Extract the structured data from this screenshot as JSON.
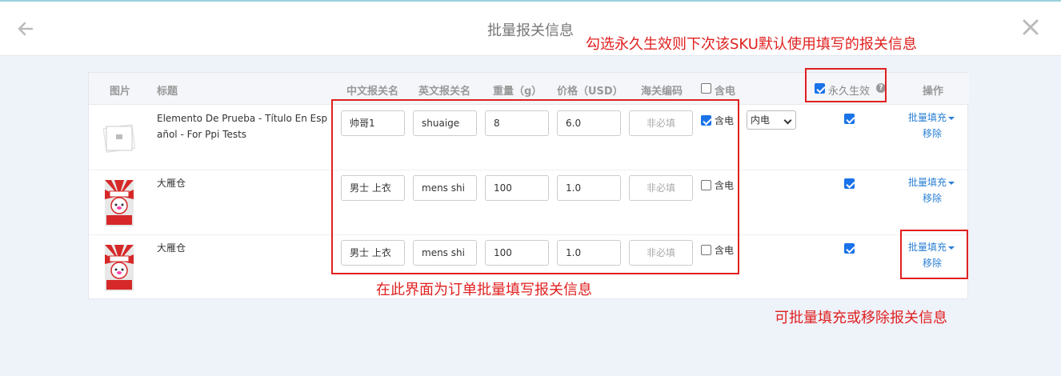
{
  "header": {
    "title": "批量报关信息"
  },
  "annotations": {
    "permanent_note": "勾选永久生效则下次该SKU默认使用填写的报关信息",
    "batch_edit_note": "在此界面为订单批量填写报关信息",
    "batch_fill_note": "可批量填充或移除报关信息"
  },
  "table": {
    "headers": {
      "image": "图片",
      "title": "标题",
      "cn_name": "中文报关名",
      "en_name": "英文报关名",
      "weight": "重量（g）",
      "price": "价格（USD）",
      "hs_code": "海关编码",
      "battery": "含电",
      "permanent": "永久生效",
      "action": "操作"
    },
    "rows": [
      {
        "title": "Elemento De Prueba - Título En Español - For Ppi Tests",
        "cn_name": "帅哥1",
        "en_name": "shuaige",
        "weight": "8",
        "price": "6.0",
        "hs_code_placeholder": "非必填",
        "battery_label": "含电",
        "battery_checked": true,
        "battery_type": "内电",
        "permanent_checked": true,
        "batch_fill": "批量填充",
        "remove": "移除"
      },
      {
        "title": "大雁仓",
        "cn_name": "男士 上衣",
        "en_name": "mens shi",
        "weight": "100",
        "price": "1.0",
        "hs_code_placeholder": "非必填",
        "battery_label": "含电",
        "battery_checked": false,
        "permanent_checked": true,
        "batch_fill": "批量填充",
        "remove": "移除"
      },
      {
        "title": "大雁仓",
        "cn_name": "男士 上衣",
        "en_name": "mens shi",
        "weight": "100",
        "price": "1.0",
        "hs_code_placeholder": "非必填",
        "battery_label": "含电",
        "battery_checked": false,
        "permanent_checked": true,
        "batch_fill": "批量填充",
        "remove": "移除"
      }
    ]
  },
  "colors": {
    "accent": "#2a7fd4",
    "annotation": "#e02020",
    "checkbox": "#1a73e8"
  }
}
